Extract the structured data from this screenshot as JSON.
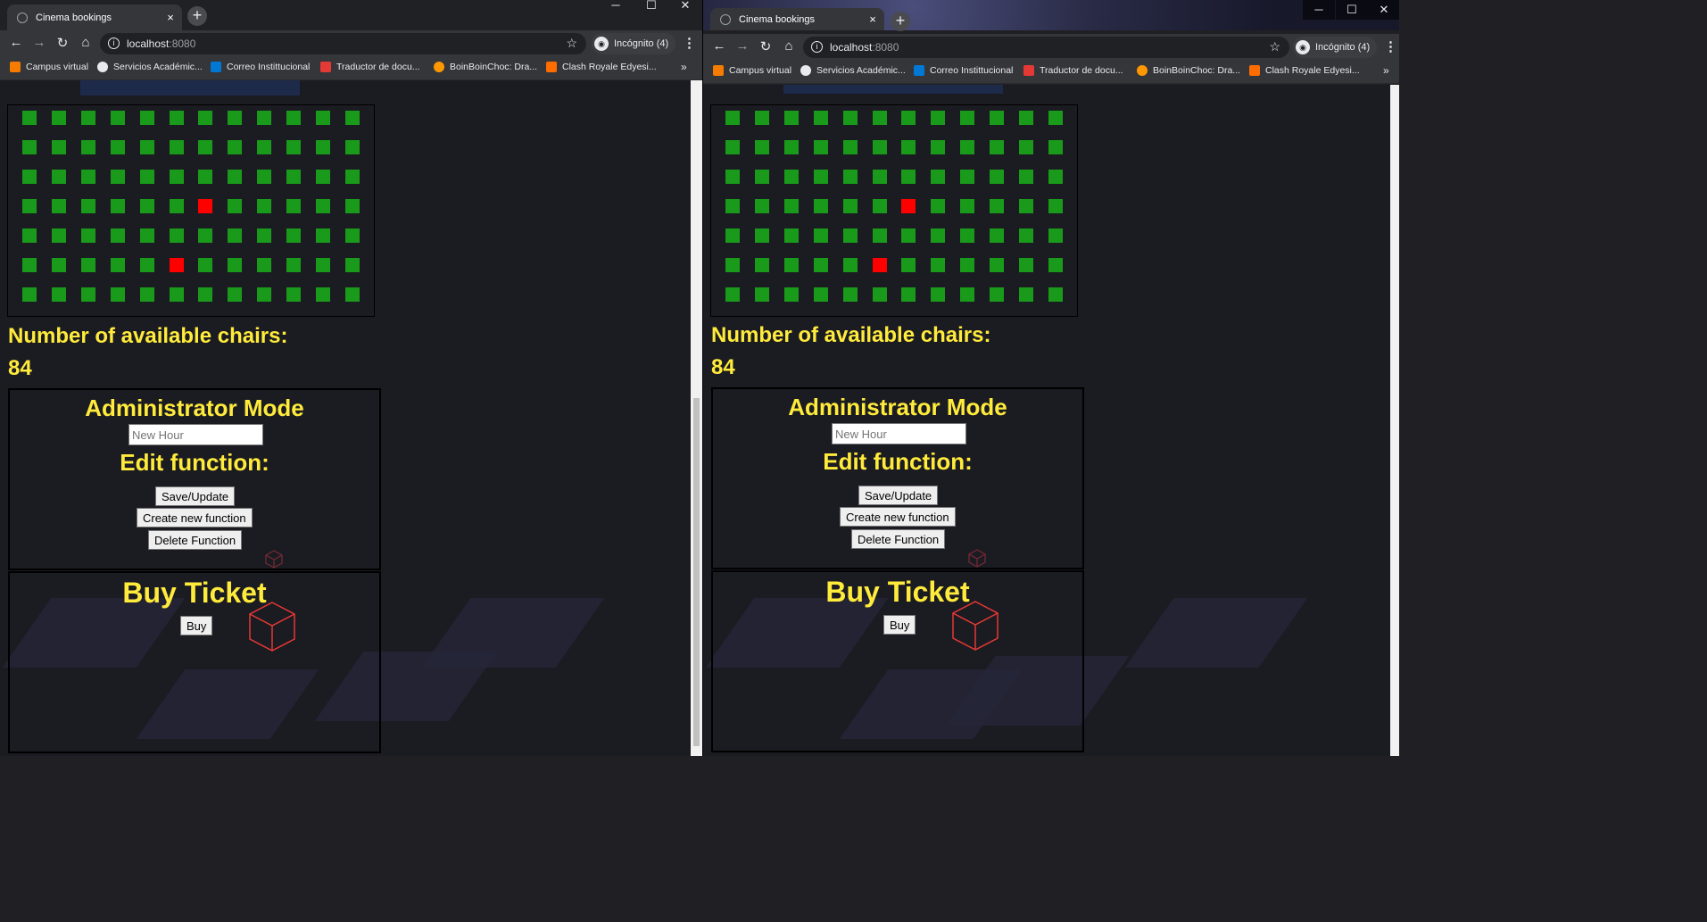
{
  "browser": {
    "tab_title": "Cinema bookings",
    "tab_close": "×",
    "new_tab": "+",
    "url_host": "localhost",
    "url_port": ":8080",
    "incognito_label": "Incógnito (4)",
    "window_minimize": "─",
    "window_maximize": "☐",
    "window_close": "✕",
    "bookmarks": [
      {
        "label": "Campus virtual",
        "color": "#f57c00"
      },
      {
        "label": "Servicios Académic...",
        "color": "#e8eaed"
      },
      {
        "label": "Correo Instittucional",
        "color": "#0078d4"
      },
      {
        "label": "Traductor de docu...",
        "color": "#e53935"
      },
      {
        "label": "BoinBoinChoc: Dra...",
        "color": "#ff9800"
      },
      {
        "label": "Clash Royale Edyesi...",
        "color": "#ff6d00"
      }
    ],
    "bookmarks_more": "»"
  },
  "page": {
    "seat_grid": {
      "rows": 7,
      "cols": 12,
      "taken": [
        [
          3,
          6
        ],
        [
          5,
          5
        ]
      ],
      "available_color": "#1a9a1a",
      "taken_color": "#ff0000"
    },
    "available_label": "Number of available chairs:",
    "available_count": "84",
    "admin": {
      "title": "Administrator Mode",
      "hour_placeholder": "New Hour",
      "edit_title": "Edit function:",
      "save_label": "Save/Update",
      "create_label": "Create new function",
      "delete_label": "Delete Function"
    },
    "buy": {
      "title": "Buy Ticket",
      "buy_label": "Buy"
    },
    "accent_color": "#ffeb3b"
  }
}
